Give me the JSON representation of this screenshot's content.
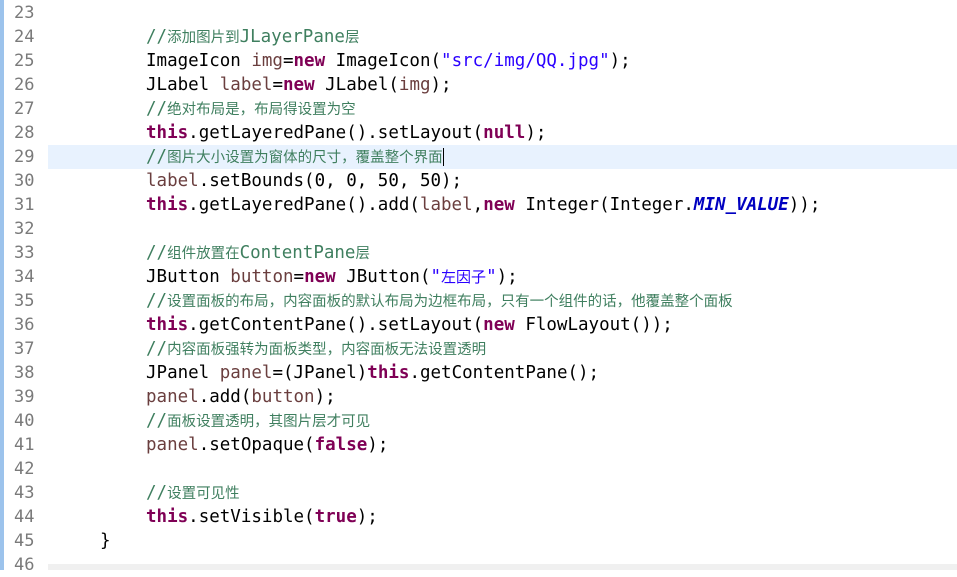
{
  "editor": {
    "lines": [
      {
        "no": "23",
        "parts": []
      },
      {
        "no": "24",
        "parts": [
          {
            "t": "//添加图片到JLayerPane层",
            "c": "cmt"
          }
        ]
      },
      {
        "no": "25",
        "parts": [
          {
            "t": "ImageIcon ",
            "c": ""
          },
          {
            "t": "img",
            "c": "var"
          },
          {
            "t": "=",
            "c": ""
          },
          {
            "t": "new",
            "c": "kw"
          },
          {
            "t": " ImageIcon(",
            "c": ""
          },
          {
            "t": "\"src/img/QQ.jpg\"",
            "c": "str"
          },
          {
            "t": ");",
            "c": ""
          }
        ]
      },
      {
        "no": "26",
        "parts": [
          {
            "t": "JLabel ",
            "c": ""
          },
          {
            "t": "label",
            "c": "var"
          },
          {
            "t": "=",
            "c": ""
          },
          {
            "t": "new",
            "c": "kw"
          },
          {
            "t": " JLabel(",
            "c": ""
          },
          {
            "t": "img",
            "c": "var"
          },
          {
            "t": ");",
            "c": ""
          }
        ]
      },
      {
        "no": "27",
        "parts": [
          {
            "t": "//绝对布局是，布局得设置为空",
            "c": "cmt"
          }
        ]
      },
      {
        "no": "28",
        "parts": [
          {
            "t": "this",
            "c": "kw"
          },
          {
            "t": ".getLayeredPane().setLayout(",
            "c": ""
          },
          {
            "t": "null",
            "c": "kw"
          },
          {
            "t": ");",
            "c": ""
          }
        ]
      },
      {
        "no": "29",
        "parts": [
          {
            "t": "//图片大小设置为窗体的尺寸，覆盖整个界面",
            "c": "cmt"
          }
        ],
        "highlight": true,
        "caret": true
      },
      {
        "no": "30",
        "parts": [
          {
            "t": "label",
            "c": "var"
          },
          {
            "t": ".setBounds(0, 0, 50, 50);",
            "c": ""
          }
        ]
      },
      {
        "no": "31",
        "parts": [
          {
            "t": "this",
            "c": "kw"
          },
          {
            "t": ".getLayeredPane().add(",
            "c": ""
          },
          {
            "t": "label",
            "c": "var"
          },
          {
            "t": ",",
            "c": ""
          },
          {
            "t": "new",
            "c": "kw"
          },
          {
            "t": " Integer(Integer.",
            "c": ""
          },
          {
            "t": "MIN_VALUE",
            "c": "static"
          },
          {
            "t": "));",
            "c": ""
          }
        ]
      },
      {
        "no": "32",
        "parts": []
      },
      {
        "no": "33",
        "parts": [
          {
            "t": "//组件放置在ContentPane层",
            "c": "cmt"
          }
        ]
      },
      {
        "no": "34",
        "parts": [
          {
            "t": "JButton ",
            "c": ""
          },
          {
            "t": "button",
            "c": "var"
          },
          {
            "t": "=",
            "c": ""
          },
          {
            "t": "new",
            "c": "kw"
          },
          {
            "t": " JButton(",
            "c": ""
          },
          {
            "t": "\"左因子\"",
            "c": "str"
          },
          {
            "t": ");",
            "c": ""
          }
        ]
      },
      {
        "no": "35",
        "parts": [
          {
            "t": "//设置面板的布局，内容面板的默认布局为边框布局，只有一个组件的话，他覆盖整个面板",
            "c": "cmt"
          }
        ]
      },
      {
        "no": "36",
        "parts": [
          {
            "t": "this",
            "c": "kw"
          },
          {
            "t": ".getContentPane().setLayout(",
            "c": ""
          },
          {
            "t": "new",
            "c": "kw"
          },
          {
            "t": " FlowLayout());",
            "c": ""
          }
        ]
      },
      {
        "no": "37",
        "parts": [
          {
            "t": "//内容面板强转为面板类型，内容面板无法设置透明",
            "c": "cmt"
          }
        ]
      },
      {
        "no": "38",
        "parts": [
          {
            "t": "JPanel ",
            "c": ""
          },
          {
            "t": "panel",
            "c": "var"
          },
          {
            "t": "=(JPanel)",
            "c": ""
          },
          {
            "t": "this",
            "c": "kw"
          },
          {
            "t": ".getContentPane();",
            "c": ""
          }
        ]
      },
      {
        "no": "39",
        "parts": [
          {
            "t": "panel",
            "c": "var"
          },
          {
            "t": ".add(",
            "c": ""
          },
          {
            "t": "button",
            "c": "var"
          },
          {
            "t": ");",
            "c": ""
          }
        ]
      },
      {
        "no": "40",
        "parts": [
          {
            "t": "//面板设置透明，其图片层才可见",
            "c": "cmt"
          }
        ]
      },
      {
        "no": "41",
        "parts": [
          {
            "t": "panel",
            "c": "var"
          },
          {
            "t": ".setOpaque(",
            "c": ""
          },
          {
            "t": "false",
            "c": "kw"
          },
          {
            "t": ");",
            "c": ""
          }
        ]
      },
      {
        "no": "42",
        "parts": []
      },
      {
        "no": "43",
        "parts": [
          {
            "t": "//设置可见性",
            "c": "cmt"
          }
        ]
      },
      {
        "no": "44",
        "parts": [
          {
            "t": "this",
            "c": "kw"
          },
          {
            "t": ".setVisible(",
            "c": ""
          },
          {
            "t": "true",
            "c": "kw"
          },
          {
            "t": ");",
            "c": ""
          }
        ]
      },
      {
        "no": "45",
        "parts": [
          {
            "t": "}",
            "c": ""
          }
        ],
        "outdent": true
      },
      {
        "no": "46",
        "parts": []
      }
    ]
  }
}
